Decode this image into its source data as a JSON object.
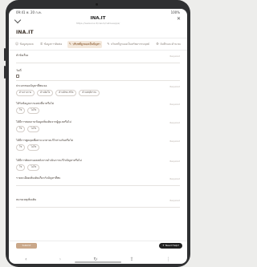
{
  "status": {
    "time": "09:41 พ. 20 ก.ค.",
    "battery": "100%"
  },
  "browser": {
    "title": "INA.IT",
    "url": "https://www.ina.it/cwsm/nativeapps/"
  },
  "brand": "INA.IT",
  "tabs": [
    {
      "label": "ข้อมูลบุคคล",
      "icon": "user-icon"
    },
    {
      "label": "ข้อมูลการติดต่อ",
      "icon": "phone-icon"
    },
    {
      "label": "บริบทที่ถูกมองเป็นปัญหา",
      "icon": "edit-icon",
      "active": true
    },
    {
      "label": "บริบทที่ถูกมองเป็นทรัพยากรมนุษย์",
      "icon": "edit-icon"
    },
    {
      "label": "บันทึกและคำนวณ",
      "icon": "gear-icon"
    }
  ],
  "fields": {
    "title": {
      "label": "หัวข้อเรื่อง",
      "required": "Required"
    },
    "date": {
      "label": "วันที่",
      "required": ""
    },
    "type": {
      "label": "ประเภทของปัญหาที่พบเจอ",
      "required": "Required",
      "options": [
        "ด้านร่างกาย",
        "ด้านจิตใจ",
        "ด้านทักษะชีวิต",
        "ด้านพฤติกรรม"
      ]
    },
    "q1": {
      "label": "ได้รับข้อมูลจากแหล่งที่มาหรือไม่",
      "required": "Required",
      "options": [
        "ใช่",
        "ไม่ใช่"
      ]
    },
    "q2": {
      "label": "ได้มีการสอบถามข้อมูลเพิ่มเติมจากผู้ดูแลหรือไม่",
      "required": "Required",
      "options": [
        "ใช่",
        "ไม่ใช่"
      ]
    },
    "q3": {
      "label": "ได้มีการพูดคุยเพื่อหาแนวทางแก้ไขร่วมกันหรือไม่",
      "required": "Required",
      "options": [
        "ใช่",
        "ไม่ใช่"
      ]
    },
    "q4": {
      "label": "ได้มีการติดตามผลหลังจากดำเนินการแก้ไขปัญหาหรือไม่",
      "required": "Required",
      "options": [
        "ใช่",
        "ไม่ใช่"
      ]
    },
    "detail": {
      "label": "รายละเอียดเพิ่มเติมเกี่ยวกับปัญหาที่พบ",
      "required": "Required"
    },
    "note": {
      "label": "หมายเหตุเพิ่มเติม",
      "required": "Required"
    }
  },
  "footer": {
    "save": "Submit",
    "help": "Need Help?"
  }
}
